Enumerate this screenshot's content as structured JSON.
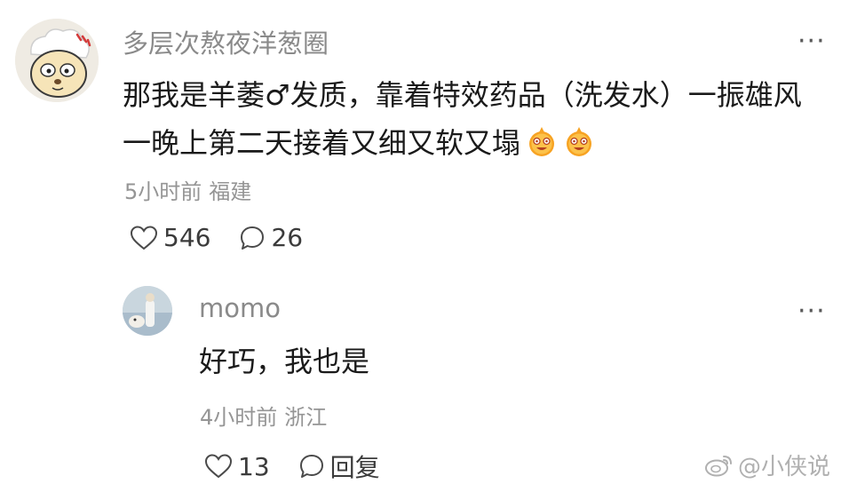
{
  "comment": {
    "username": "多层次熬夜洋葱圈",
    "more": "···",
    "lines": [
      "那我是羊萎♂发质，靠着特效药品（洗发水）一振雄风",
      "一晚上第二天接着又细又软又塌"
    ],
    "time": "5小时前",
    "location": "福建",
    "likes": "546",
    "replies": "26"
  },
  "reply": {
    "username": "momo",
    "more": "···",
    "text": "好巧，我也是",
    "time": "4小时前",
    "location": "浙江",
    "likes": "13",
    "reply_label": "回复"
  },
  "watermark": "@小侠说",
  "colors": {
    "emoji": "#f7a323",
    "text": "#1a1a1a",
    "meta": "#959595"
  },
  "icons": [
    "heart-icon",
    "comment-icon",
    "more-icon",
    "weibo-icon",
    "laugh-emoji"
  ]
}
